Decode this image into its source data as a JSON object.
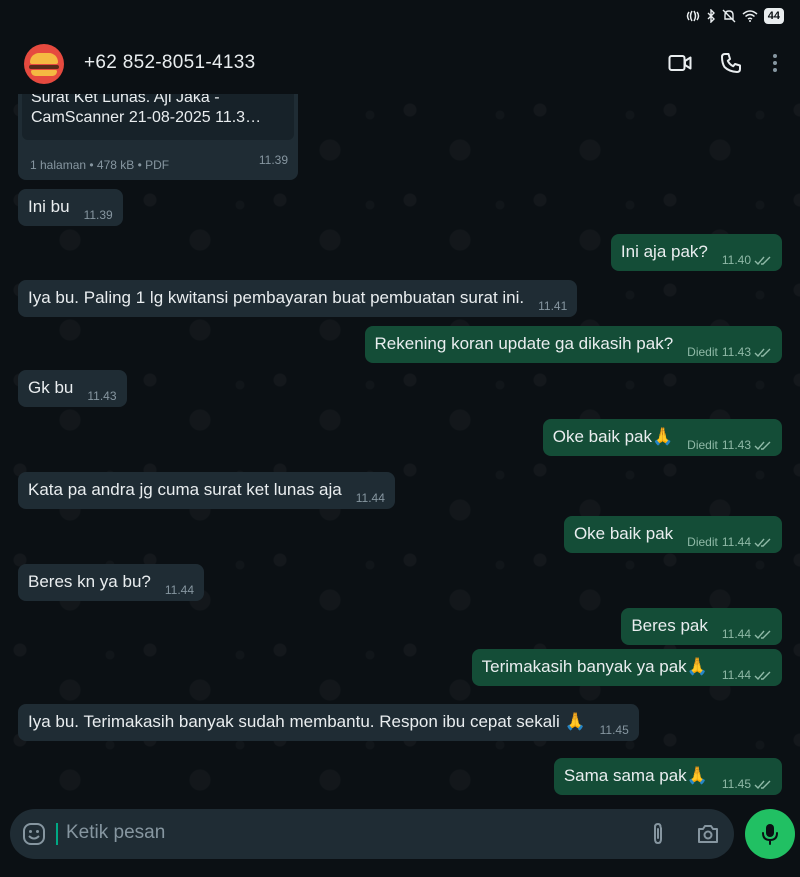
{
  "status": {
    "battery": "44"
  },
  "header": {
    "contact": "+62 852-8051-4133"
  },
  "doc": {
    "title": "Surat Ket Lunas. Aji Jaka - CamScanner 21-08-2025 11.3…",
    "meta": "1 halaman  •  478 kB  •  PDF",
    "time": "11.39"
  },
  "messages": [
    {
      "dir": "in",
      "text": "Ini bu",
      "time": "11.39",
      "edited": ""
    },
    {
      "dir": "out",
      "text": "Ini aja pak?",
      "time": "11.40",
      "edited": ""
    },
    {
      "dir": "in",
      "text": "Iya bu. Paling 1 lg kwitansi pembayaran buat pembuatan surat ini.",
      "time": "11.41",
      "edited": ""
    },
    {
      "dir": "out",
      "text": "Rekening koran update ga dikasih pak?",
      "time": "11.43",
      "edited": "Diedit"
    },
    {
      "dir": "in",
      "text": "Gk bu",
      "time": "11.43",
      "edited": ""
    },
    {
      "dir": "out",
      "text": "Oke baik pak🙏",
      "time": "11.43",
      "edited": "Diedit"
    },
    {
      "dir": "in",
      "text": "Kata pa andra jg cuma surat ket lunas aja",
      "time": "11.44",
      "edited": ""
    },
    {
      "dir": "out",
      "text": "Oke baik pak",
      "time": "11.44",
      "edited": "Diedit"
    },
    {
      "dir": "in",
      "text": "Beres kn ya bu?",
      "time": "11.44",
      "edited": ""
    },
    {
      "dir": "out",
      "text": "Beres pak",
      "time": "11.44",
      "edited": ""
    },
    {
      "dir": "out",
      "text": "Terimakasih banyak ya pak🙏",
      "time": "11.44",
      "edited": ""
    },
    {
      "dir": "in",
      "text": "Iya bu. Terimakasih banyak sudah membantu. Respon ibu cepat sekali 🙏",
      "time": "11.45",
      "edited": ""
    },
    {
      "dir": "out",
      "text": "Sama sama pak🙏",
      "time": "11.45",
      "edited": ""
    }
  ],
  "composer": {
    "placeholder": "Ketik pesan"
  },
  "icons": {
    "video": "video-call-icon",
    "phone": "phone-icon",
    "menu": "more-vert-icon",
    "emoji": "emoji-icon",
    "attach": "attach-icon",
    "camera": "camera-icon",
    "mic": "mic-icon"
  },
  "colors": {
    "incoming": "#1f2c34",
    "outgoing": "#144d37",
    "accent": "#21c063"
  }
}
